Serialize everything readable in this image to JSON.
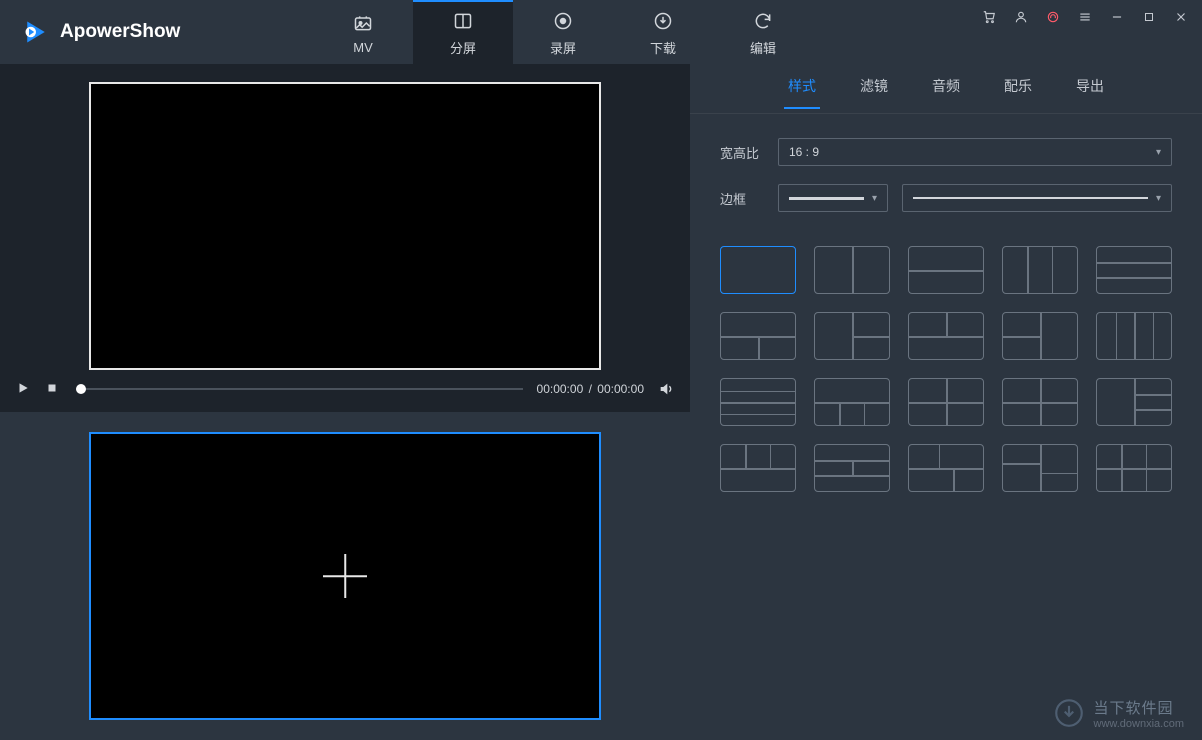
{
  "app_name": "ApowerShow",
  "main_tabs": [
    {
      "id": "mv",
      "label": "MV"
    },
    {
      "id": "split",
      "label": "分屏"
    },
    {
      "id": "record",
      "label": "录屏"
    },
    {
      "id": "download",
      "label": "下载"
    },
    {
      "id": "edit",
      "label": "编辑"
    }
  ],
  "main_tab_active": "split",
  "player": {
    "current_time": "00:00:00",
    "total_time": "00:00:00",
    "separator": "/"
  },
  "sub_tabs": [
    {
      "id": "style",
      "label": "样式"
    },
    {
      "id": "filter",
      "label": "滤镜"
    },
    {
      "id": "audio",
      "label": "音频"
    },
    {
      "id": "music",
      "label": "配乐"
    },
    {
      "id": "export",
      "label": "导出"
    }
  ],
  "sub_tab_active": "style",
  "controls": {
    "aspect_label": "宽高比",
    "aspect_value": "16 : 9",
    "border_label": "边框"
  },
  "watermark": {
    "title": "当下软件园",
    "url": "www.downxia.com"
  }
}
